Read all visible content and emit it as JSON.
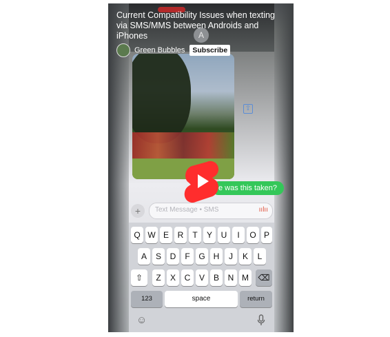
{
  "video": {
    "title": "Current Compatibility Issues when texting via SMS/MMS between Androids and iPhones",
    "channel_name": "Green Bubbles",
    "subscribe_label": "Subscribe"
  },
  "contact_avatar_letter": "A",
  "conversation": {
    "bubble_text": "e was this taken?",
    "input_placeholder": "Text Message • SMS",
    "plus_label": "+"
  },
  "keyboard": {
    "row1": [
      "Q",
      "W",
      "E",
      "R",
      "T",
      "Y",
      "U",
      "I",
      "O",
      "P"
    ],
    "row2": [
      "A",
      "S",
      "D",
      "F",
      "G",
      "H",
      "J",
      "K",
      "L"
    ],
    "row3": [
      "Z",
      "X",
      "C",
      "V",
      "B",
      "N",
      "M"
    ],
    "shift_label": "⇧",
    "delete_label": "⌫",
    "numbers_label": "123",
    "space_label": "space",
    "return_label": "return"
  },
  "icons": {
    "play": "play-icon",
    "emoji": "emoji-icon",
    "mic": "microphone-icon",
    "share": "share-icon",
    "audio": "audio-wave-icon"
  },
  "colors": {
    "play_red": "#ff2d2d",
    "imessage_green": "#34c759",
    "subscribe_bg": "#ffffff"
  }
}
